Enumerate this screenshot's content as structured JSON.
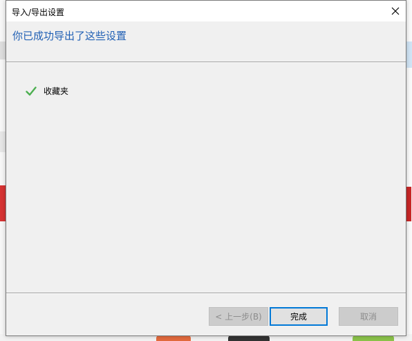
{
  "dialog": {
    "title": "导入/导出设置",
    "heading": "你已成功导出了这些设置",
    "items": [
      {
        "label": "收藏夹",
        "status": "success"
      }
    ],
    "buttons": {
      "back": "< 上一步(B)",
      "finish": "完成",
      "cancel": "取消"
    }
  },
  "colors": {
    "heading": "#1f5fb4",
    "check": "#4caf50",
    "focus_border": "#0078d7"
  },
  "icons": {
    "close": "close-icon",
    "check": "check-icon"
  }
}
